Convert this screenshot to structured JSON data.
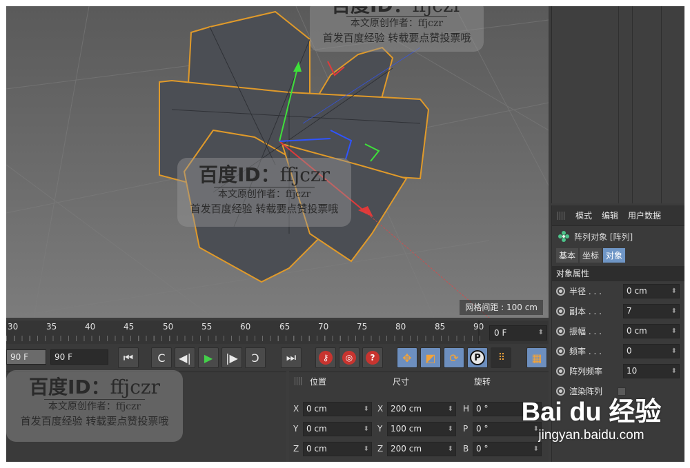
{
  "viewport": {
    "grid_info": "网格间距 : 100 cm"
  },
  "timeline": {
    "ticks": [
      "30",
      "35",
      "40",
      "45",
      "50",
      "55",
      "60",
      "65",
      "70",
      "75",
      "80",
      "85",
      "90"
    ],
    "current_frame": "0 F"
  },
  "transport": {
    "start_field": "90 F",
    "end_field": "90 F",
    "btn_goto_start": "⏮",
    "btn_prev_key": "C",
    "btn_prev_frame": "◀|",
    "btn_play": "▶",
    "btn_next_frame": "|▶",
    "btn_next_key": "Ↄ",
    "btn_goto_end": "⏭",
    "btn_help": "?",
    "btn_p": "P"
  },
  "attributes": {
    "menu": [
      "模式",
      "编辑",
      "用户数据"
    ],
    "object_title": "阵列对象 [阵列]",
    "tabs": [
      "基本",
      "坐标",
      "对象"
    ],
    "section": "对象属性",
    "properties": [
      {
        "label": "半径 . . .",
        "value": "0 cm"
      },
      {
        "label": "副本 . . .",
        "value": "7"
      },
      {
        "label": "振幅 . . .",
        "value": "0 cm"
      },
      {
        "label": "频率 . . .",
        "value": "0"
      },
      {
        "label": "阵列频率",
        "value": "10"
      },
      {
        "label": "渲染阵列"
      }
    ]
  },
  "coordinates": {
    "headers": [
      "位置",
      "尺寸",
      "旋转"
    ],
    "rows": [
      {
        "pos_axis": "X",
        "pos": "0 cm",
        "size_axis": "X",
        "size": "200 cm",
        "rot_axis": "H",
        "rot": "0 °"
      },
      {
        "pos_axis": "Y",
        "pos": "0 cm",
        "size_axis": "Y",
        "size": "100 cm",
        "rot_axis": "P",
        "rot": "0 °"
      },
      {
        "pos_axis": "Z",
        "pos": "0 cm",
        "size_axis": "Z",
        "size": "200 cm",
        "rot_axis": "B",
        "rot": "0 °"
      }
    ]
  },
  "watermark": {
    "id_line": "百度ID：",
    "id_name": "ffjczr",
    "author_line": "本文原创作者：ffjczr",
    "notice_line": "首发百度经验 转载要点赞投票哦"
  },
  "baidu": {
    "logo": "Bai du 经验",
    "url": "jingyan.baidu.com"
  },
  "colors": {
    "highlight_tab": "#6f96c6",
    "selection_outline": "#e09a2a",
    "play_green": "#44d04a"
  }
}
